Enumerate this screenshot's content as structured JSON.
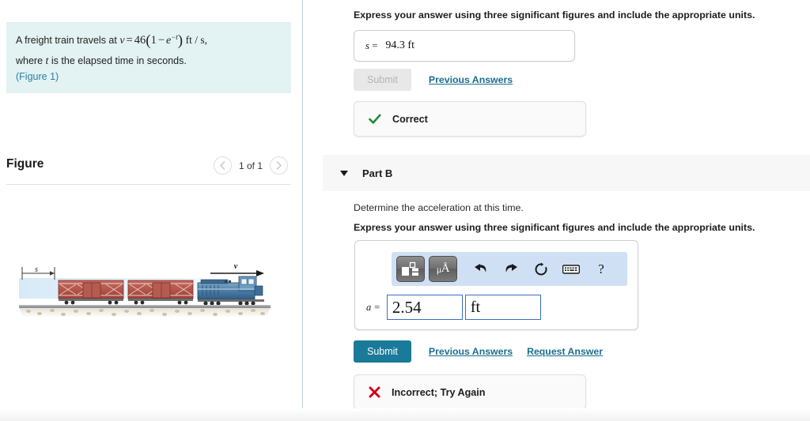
{
  "left_panel": {
    "question": {
      "line1_prefix": "A freight train travels at",
      "math": {
        "var_v": "v",
        "equals": "=",
        "coefficient": "46",
        "open_paren": "(",
        "one": "1",
        "minus": "−",
        "e": "e",
        "exponent": "−t",
        "close_paren": ")",
        "units": "ft / s,"
      },
      "line2": "where",
      "line2_var": "t",
      "line2_rest": "is the elapsed time in seconds.",
      "figure_ref_open": "(",
      "figure_ref": "Figure 1",
      "figure_ref_close": ")"
    },
    "figure": {
      "title": "Figure",
      "counter": "1 of 1",
      "prev_icon": "chevron-left-icon",
      "next_icon": "chevron-right-icon",
      "art_labels": {
        "distance": "s",
        "velocity": "v"
      }
    }
  },
  "right_panel": {
    "part_a": {
      "instruction": "Express your answer using three significant figures and include the appropriate units.",
      "answer_label": "s",
      "answer_equals": "=",
      "answer_value": "94.3 ft",
      "submit_label": "Submit",
      "previous_answers_label": "Previous Answers",
      "status_icon": "check-icon",
      "status_text": "Correct",
      "status_color": "#1b8a3a"
    },
    "part_b": {
      "header_title": "Part B",
      "caret_icon": "caret-down-icon",
      "question": "Determine the acceleration at this time.",
      "instruction": "Express your answer using three significant figures and include the appropriate units.",
      "toolbar": {
        "template_icon": "math-template-icon",
        "units_icon": "micro-angstrom-units-icon",
        "units_label_mu": "μ",
        "units_label_a": "Å",
        "undo_icon": "undo-arrow-icon",
        "redo_icon": "redo-arrow-icon",
        "reset_icon": "reset-circle-icon",
        "keyboard_icon": "keyboard-icon",
        "help_icon": "question-mark-icon",
        "help_label": "?",
        "background_color": "#cfe0f5"
      },
      "answer_label": "a",
      "answer_equals": "=",
      "answer_value": "2.54",
      "answer_unit": "ft",
      "submit_label": "Submit",
      "previous_answers_label": "Previous Answers",
      "request_answer_label": "Request Answer",
      "submit_color": "#1a7a99",
      "status_icon": "cross-icon",
      "status_text": "Incorrect; Try Again",
      "status_color": "#d0021b"
    }
  }
}
